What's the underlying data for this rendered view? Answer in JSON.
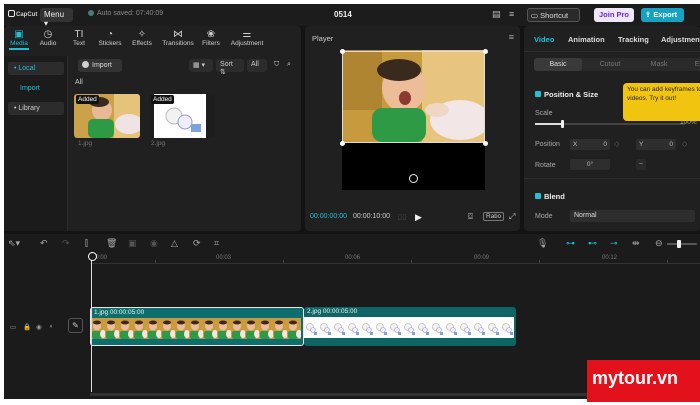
{
  "topbar": {
    "logo": "CapCut",
    "menu_label": "Menu ▾",
    "autosave": "Auto saved: 07:40:09",
    "project_title": "0514",
    "shortcut_label": "Shortcut",
    "joinpro_label": "Join Pro",
    "export_label": "Export"
  },
  "media_tabs": [
    {
      "label": "Media",
      "icon": "media-icon",
      "glyph": "▣"
    },
    {
      "label": "Audio",
      "icon": "audio-icon",
      "glyph": "◷"
    },
    {
      "label": "Text",
      "icon": "text-icon",
      "glyph": "TI"
    },
    {
      "label": "Stickers",
      "icon": "sticker-icon",
      "glyph": "◔"
    },
    {
      "label": "Effects",
      "icon": "effects-icon",
      "glyph": "✧"
    },
    {
      "label": "Transitions",
      "icon": "transitions-icon",
      "glyph": "⋈"
    },
    {
      "label": "Filters",
      "icon": "filters-icon",
      "glyph": "❀"
    },
    {
      "label": "Adjustment",
      "icon": "adjustment-icon",
      "glyph": "⚌"
    }
  ],
  "side_nav": {
    "local": "• Local",
    "import": "Import",
    "library": "• Library"
  },
  "media_toolbar": {
    "import_label": "Import",
    "sort_label": "Sort",
    "all_filter": "All",
    "all_heading": "All"
  },
  "media_items": [
    {
      "badge": "Added",
      "name": "1.jpg"
    },
    {
      "badge": "Added",
      "name": "2.jpg"
    }
  ],
  "player": {
    "title": "Player",
    "current_time": "00:00:00:00",
    "total_time": "00:00:10:00",
    "ratio_label": "Ratio"
  },
  "properties": {
    "tabs": [
      "Video",
      "Animation",
      "Tracking",
      "Adjustment"
    ],
    "sub_tabs": [
      "Basic",
      "Cutout",
      "Mask",
      "Ef"
    ],
    "position_size_title": "Position & Size",
    "scale_label": "Scale",
    "scale_value": "100%",
    "position_label": "Position",
    "x_label": "X",
    "x_value": "0",
    "y_label": "Y",
    "y_value": "0",
    "rotate_label": "Rotate",
    "rotate_value": "0°",
    "blend_title": "Blend",
    "mode_label": "Mode",
    "mode_value": "Normal",
    "tooltip": "You can add keyframes to videos. Try it out!",
    "scale_level": 0.18
  },
  "timeline": {
    "ruler_labels": [
      "00:00",
      "00:03",
      "00:06",
      "00:09",
      "00:12"
    ],
    "clips": [
      {
        "label": "1.jpg  00:00:05:00"
      },
      {
        "label": "2.jpg  00:00:05:00"
      }
    ]
  },
  "watermark": "mytour.vn",
  "colors": {
    "accent": "#22bfd6",
    "clip_teal": "#0e6d6d",
    "tooltip": "#f1c40f",
    "export": "#17a2c3",
    "watermark": "#e3111b"
  }
}
